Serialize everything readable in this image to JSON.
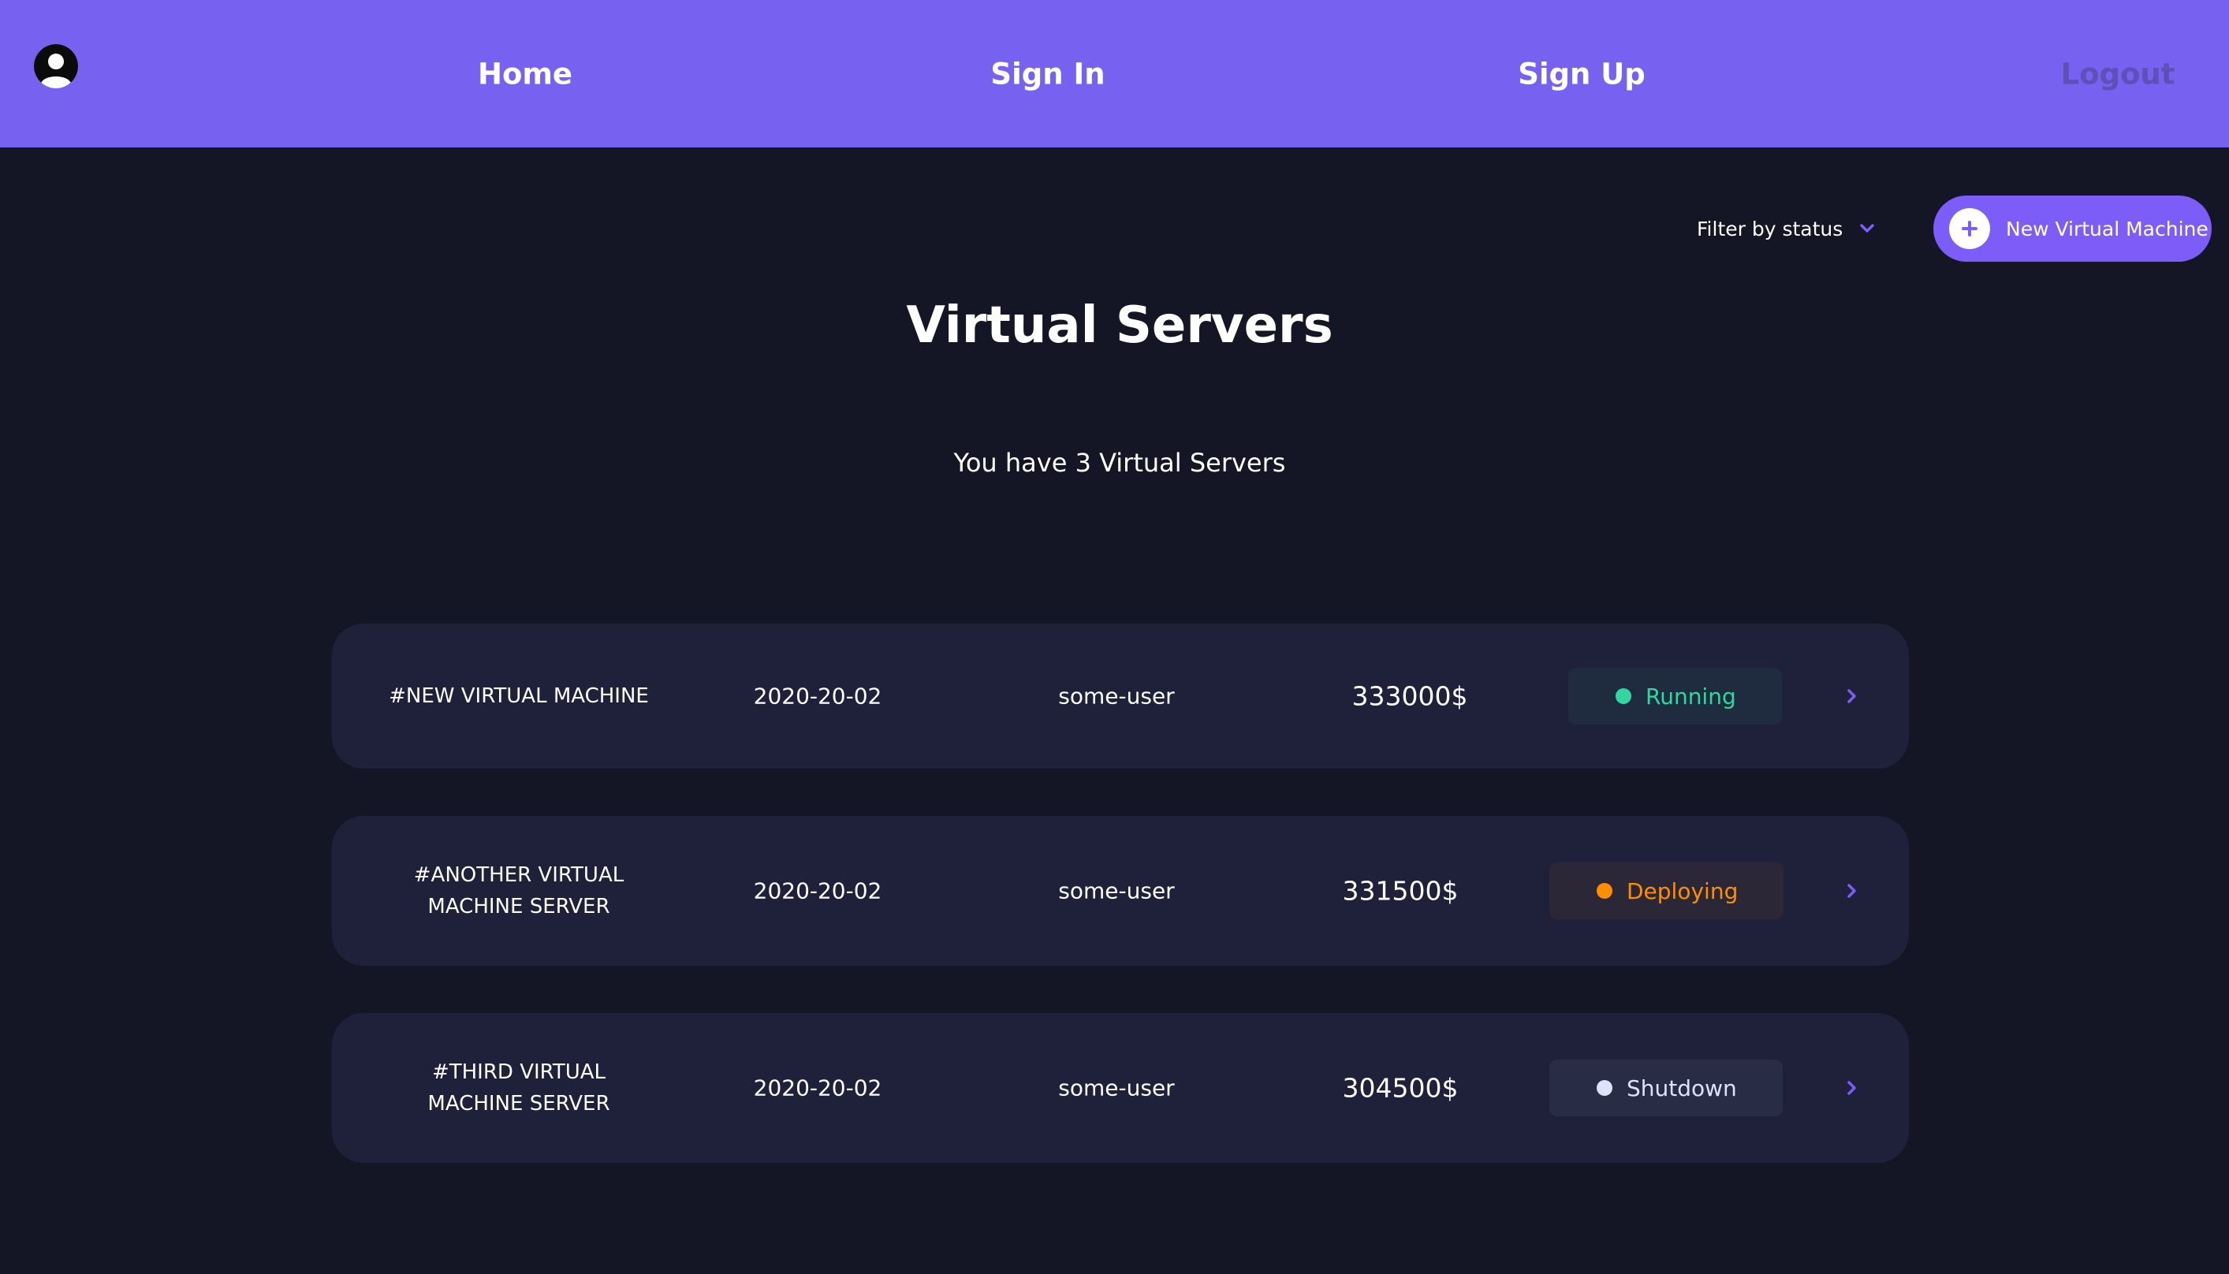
{
  "nav": {
    "links": [
      {
        "label": "Home"
      },
      {
        "label": "Sign In"
      },
      {
        "label": "Sign Up"
      },
      {
        "label": "Logout"
      }
    ]
  },
  "toolbar": {
    "filter_label": "Filter by status",
    "new_button_label": "New Virtual Machine"
  },
  "page": {
    "title": "Virtual Servers",
    "summary": "You have 3 Virtual Servers"
  },
  "servers": [
    {
      "name": "#NEW VIRTUAL MACHINE",
      "date": "2020-20-02",
      "user": "some-user",
      "amount": "333000$",
      "status": "Running",
      "status_color": "#33d69f"
    },
    {
      "name": "#ANOTHER VIRTUAL MACHINE SERVER",
      "date": "2020-20-02",
      "user": "some-user",
      "amount": "331500$",
      "status": "Deploying",
      "status_color": "#ff8f00"
    },
    {
      "name": "#THIRD VIRTUAL MACHINE SERVER",
      "date": "2020-20-02",
      "user": "some-user",
      "amount": "304500$",
      "status": "Shutdown",
      "status_color": "#dfe3fa"
    }
  ],
  "colors": {
    "navbar": "#7661f0",
    "accent": "#7c5df8",
    "background": "#141625",
    "card": "#1f213a"
  }
}
